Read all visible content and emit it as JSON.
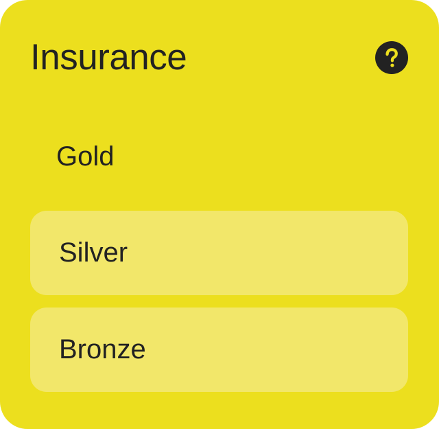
{
  "card": {
    "title": "Insurance",
    "help_icon": "help-circle-icon",
    "background_color": "#ECDF1E",
    "option_background_color": "#F2E76A",
    "text_color": "#222222"
  },
  "options": [
    {
      "label": "Gold",
      "selected": true
    },
    {
      "label": "Silver",
      "selected": false
    },
    {
      "label": "Bronze",
      "selected": false
    }
  ]
}
